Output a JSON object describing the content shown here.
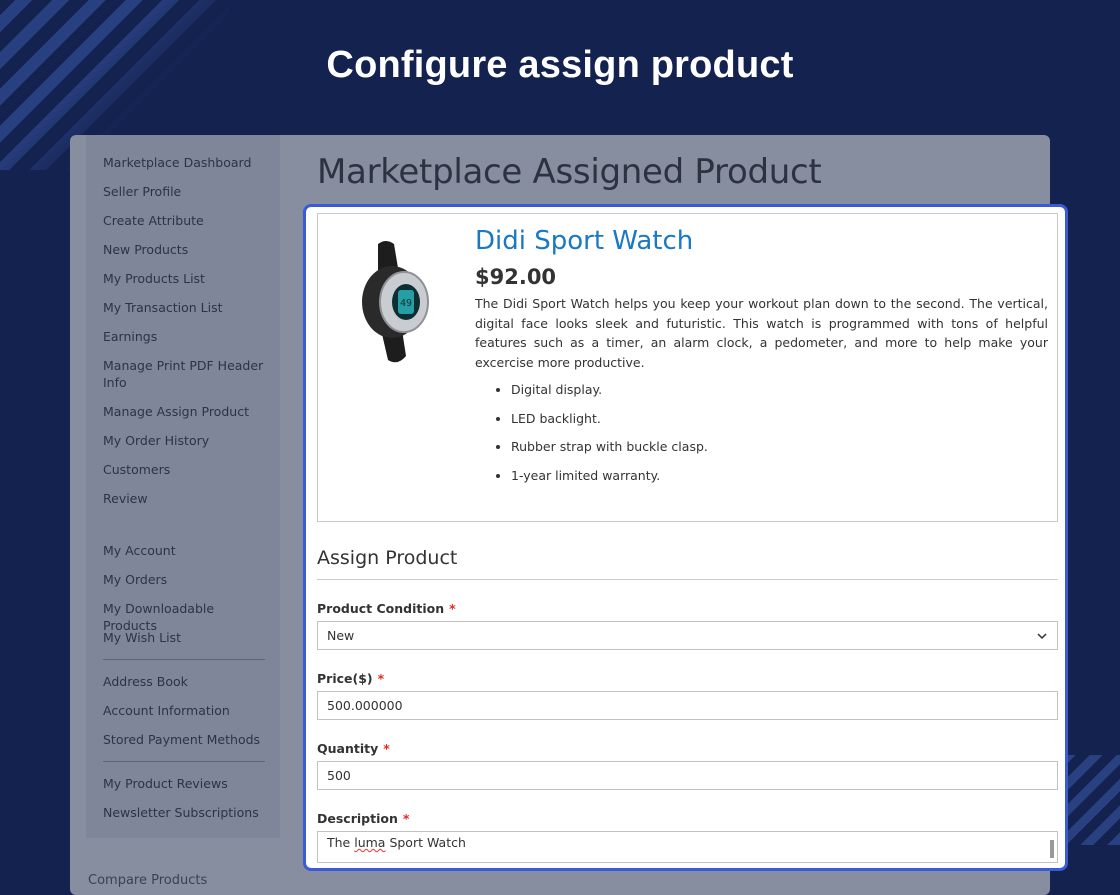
{
  "banner": {
    "title": "Configure assign product"
  },
  "sidebar": {
    "groups": [
      [
        "Marketplace Dashboard",
        "Seller Profile",
        "Create Attribute",
        "New Products",
        "My Products List",
        "My Transaction List",
        "Earnings",
        "Manage Print PDF Header Info",
        "Manage Assign Product",
        "My Order History",
        "Customers",
        "Review"
      ],
      [
        "My Account",
        "My Orders",
        "My Downloadable Products",
        "My Wish List"
      ],
      [
        "Address Book",
        "Account Information",
        "Stored Payment Methods"
      ],
      [
        "My Product Reviews",
        "Newsletter Subscriptions"
      ]
    ]
  },
  "footer": {
    "partial_label": "Compare Products"
  },
  "page": {
    "title": "Marketplace Assigned Product"
  },
  "product": {
    "name": "Didi Sport Watch",
    "price": "$92.00",
    "description": "The Didi Sport Watch helps you keep your workout plan down to the second. The vertical, digital face looks sleek and futuristic. This watch is programmed with tons of helpful features such as a timer, an alarm clock, a pedometer, and more to help make your excercise more productive.",
    "features": [
      "Digital display.",
      "LED backlight.",
      "Rubber strap with buckle clasp.",
      "1-year limited warranty."
    ],
    "image_icon": "watch-icon"
  },
  "assign_form": {
    "section_title": "Assign Product",
    "condition": {
      "label": "Product Condition",
      "value": "New"
    },
    "price": {
      "label": "Price($)",
      "value": "500.000000"
    },
    "quantity": {
      "label": "Quantity",
      "value": "500"
    },
    "description": {
      "label": "Description",
      "value_before": "The ",
      "value_misspelled": "luma",
      "value_after": " Sport Watch"
    },
    "required_mark": "*"
  },
  "colors": {
    "background": "#13224f",
    "highlight_border": "#3a5ad8",
    "link": "#1979c3",
    "required": "#e02b27"
  }
}
